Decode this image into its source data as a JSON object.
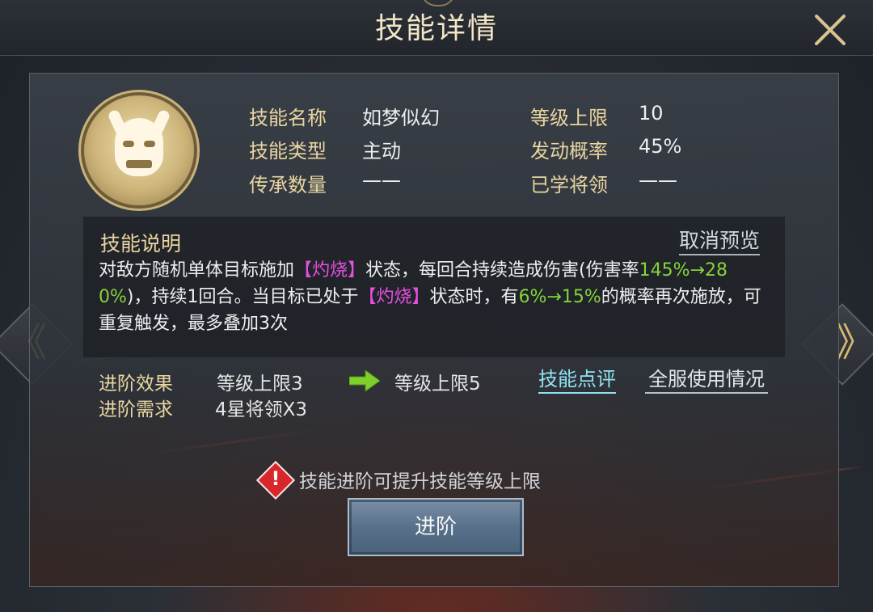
{
  "window": {
    "title": "技能详情",
    "close_icon": "close-icon"
  },
  "nav": {
    "prev_icon": "double-chevron-left-icon",
    "next_icon": "double-chevron-right-icon",
    "prev_glyph": "《",
    "next_glyph": "》"
  },
  "skill": {
    "icon": "demon-mask-icon",
    "name_label": "技能名称",
    "name_value": "如梦似幻",
    "type_label": "技能类型",
    "type_value": "主动",
    "inherit_label": "传承数量",
    "inherit_value": "——",
    "max_level_label": "等级上限",
    "max_level_value": "10",
    "trigger_label": "发动概率",
    "trigger_value": "45%",
    "learned_label": "已学将领",
    "learned_value": "——"
  },
  "description": {
    "title": "技能说明",
    "cancel_preview": "取消预览",
    "part1": "对敌方随机单体目标施加",
    "status1": "【灼烧】",
    "part2": "状态，每回合持续造成伤害(伤害率",
    "rate": "145%→280%",
    "part3": ")，持续1回合。当目标已处于",
    "status2": "【灼烧】",
    "part4": "状态时，有",
    "chance": "6%→15%",
    "part5": "的概率再次施放，可重复触发，最多叠加3次"
  },
  "advance": {
    "effect_label": "进阶效果",
    "effect_from": "等级上限3",
    "effect_to": "等级上限5",
    "arrow_icon": "green-arrow-right-icon",
    "req_label": "进阶需求",
    "req_value": "4星将领X3",
    "review_link": "技能点评",
    "usage_link": "全服使用情况"
  },
  "warning": {
    "icon": "warning-icon",
    "mark": "!",
    "text": "技能进阶可提升技能等级上限"
  },
  "button": {
    "label": "进阶"
  },
  "colors": {
    "label_gold": "#e9d5a0",
    "highlight_pink": "#e64fdf",
    "highlight_green": "#86d33a",
    "link_cyan": "#8fe3f0",
    "warning_red": "#d8262b"
  }
}
